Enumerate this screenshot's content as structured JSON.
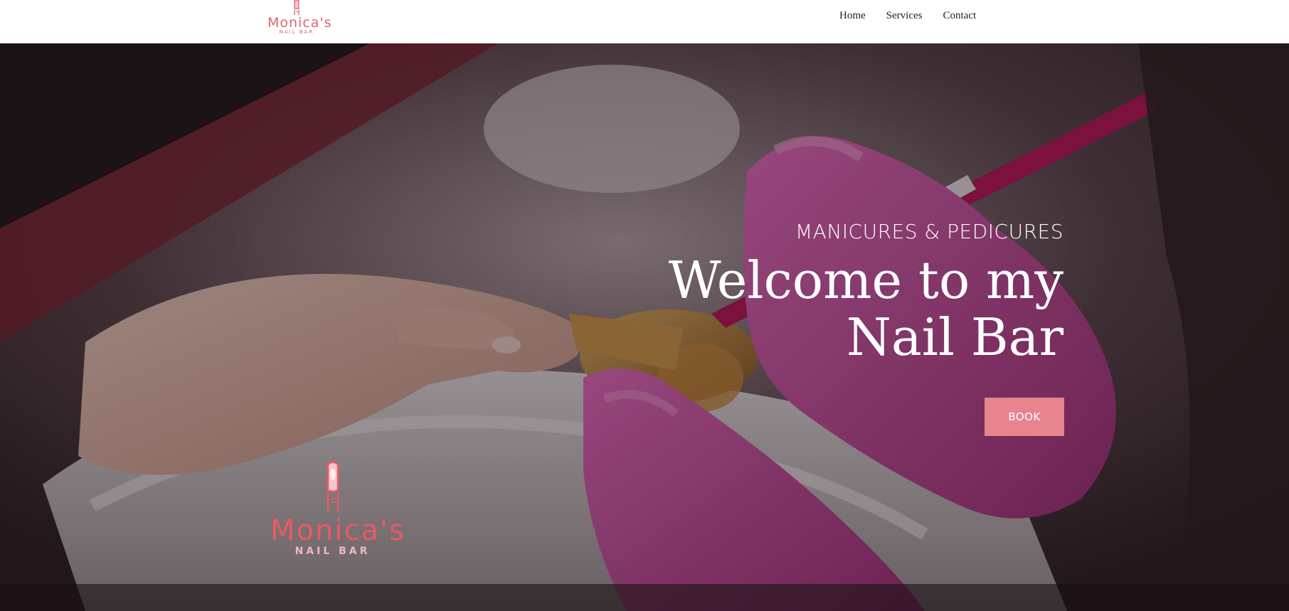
{
  "header": {
    "logo": {
      "brand": "Monica's",
      "sub": "NAIL BAR",
      "icon": "nail-icon"
    },
    "nav": [
      {
        "label": "Home"
      },
      {
        "label": "Services"
      },
      {
        "label": "Contact"
      }
    ]
  },
  "hero": {
    "eyebrow": "MANICURES & PEDICURES",
    "title_line1": "Welcome to my",
    "title_line2": "Nail Bar",
    "button": "BOOK",
    "logo": {
      "brand": "Monica's",
      "sub": "NAIL BAR",
      "icon": "nail-icon"
    },
    "background": "manicure-photo"
  },
  "colors": {
    "accent": "#e7848e",
    "logo_pink": "#e0626f",
    "glove_pink": "#c2418f"
  }
}
